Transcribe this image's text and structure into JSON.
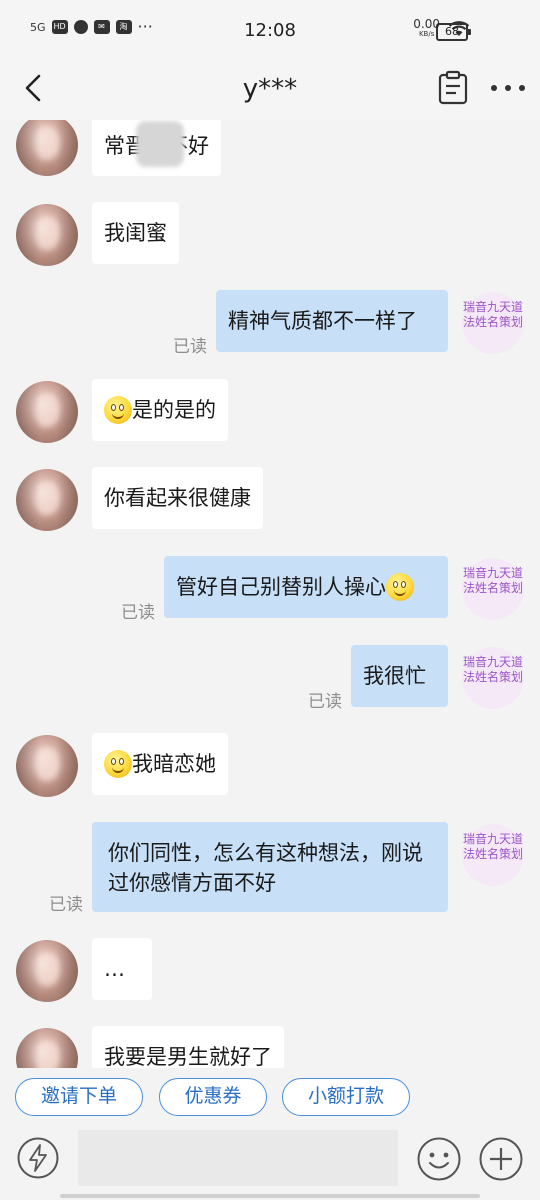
{
  "status_bar": {
    "network": "5G",
    "hd": "HD",
    "taobao": "淘",
    "more": "···",
    "time": "12:08",
    "speed_value": "0.00",
    "speed_unit": "KB/s",
    "battery": "68"
  },
  "header": {
    "title": "y***"
  },
  "my_avatar_text": "瑞音九天道法姓名策划",
  "read_label": "已读",
  "messages": [
    {
      "side": "in",
      "text": "常晋好不好"
    },
    {
      "side": "in",
      "text": "我闺蜜"
    },
    {
      "side": "out",
      "text": "精神气质都不一样了",
      "read": "已读"
    },
    {
      "side": "in",
      "text": "是的是的",
      "emoji": "smile-emoji"
    },
    {
      "side": "in",
      "text": "你看起来很健康"
    },
    {
      "side": "out",
      "text": "管好自己别替别人操心",
      "emoji": "smile-emoji",
      "read": "已读"
    },
    {
      "side": "out",
      "text": "我很忙",
      "read": "已读"
    },
    {
      "side": "in",
      "text": "我暗恋她",
      "emoji": "smile-emoji"
    },
    {
      "side": "out",
      "text": "你们同性，怎么有这种想法，刚说过你感情方面不好",
      "read": "已读"
    },
    {
      "side": "in",
      "text": "…"
    },
    {
      "side": "in",
      "text": "我要是男生就好了"
    }
  ],
  "quick_actions": [
    {
      "label": "邀请下单"
    },
    {
      "label": "优惠券"
    },
    {
      "label": "小额打款"
    }
  ],
  "input": {
    "placeholder": ""
  },
  "colors": {
    "outgoing_bubble": "#c7e0f8",
    "incoming_bubble": "#ffffff",
    "accent": "#2a6fc4",
    "avatar_text": "#9b55c9"
  }
}
